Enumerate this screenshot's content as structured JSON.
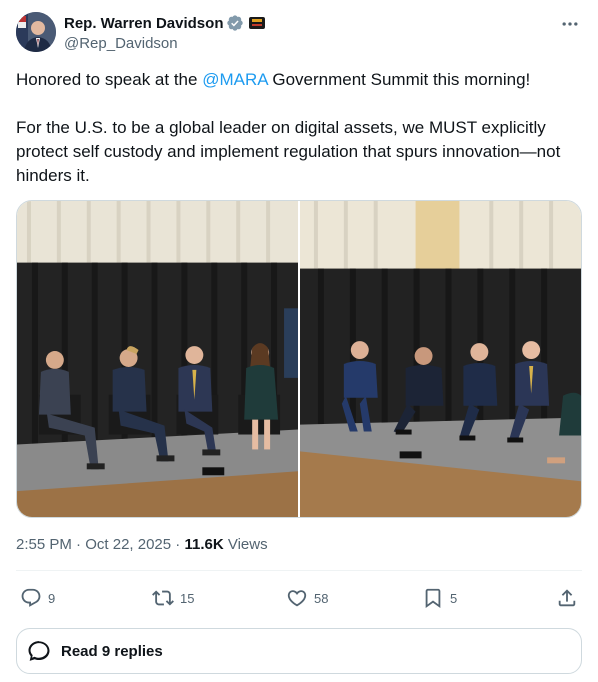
{
  "author": {
    "display_name": "Rep. Warren Davidson",
    "handle": "@Rep_Davidson"
  },
  "tweet": {
    "line1_prefix": "Honored to speak at the ",
    "mention": "@MARA",
    "line1_suffix": " Government Summit this morning!",
    "paragraph2": "For the U.S. to be a global leader on digital assets, we MUST explicitly protect self custody and implement regulation that spurs innovation—not hinders it."
  },
  "meta": {
    "time": "2:55 PM",
    "date": "Oct 22, 2025",
    "views_count": "11.6K",
    "views_label": "Views"
  },
  "actions": {
    "replies": "9",
    "reposts": "15",
    "likes": "58",
    "bookmarks": "5"
  },
  "read_replies": {
    "label": "Read 9 replies"
  },
  "icons": {
    "more": "more-icon",
    "verified": "verified-badge-icon",
    "affiliation": "affiliation-badge-icon",
    "reply": "reply-icon",
    "repost": "repost-icon",
    "like": "heart-icon",
    "bookmark": "bookmark-icon",
    "share": "share-icon",
    "chat": "chat-bubble-icon"
  },
  "colors": {
    "accent": "#1d9bf0",
    "secondary_text": "#536471",
    "primary_text": "#0f1419",
    "border": "#cfd9de"
  }
}
